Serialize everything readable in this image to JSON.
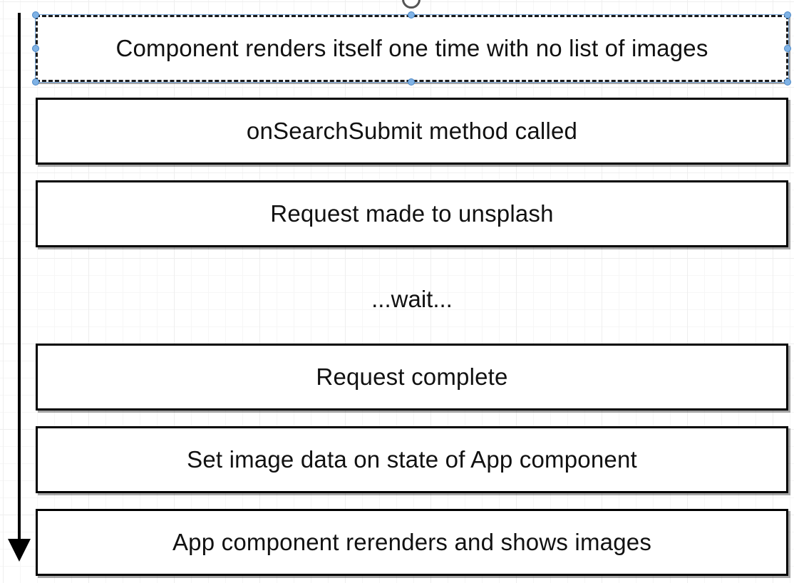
{
  "diagram": {
    "steps": [
      {
        "label": "Component renders itself one time with no list of images"
      },
      {
        "label": "onSearchSubmit method called"
      },
      {
        "label": "Request made to unsplash"
      },
      {
        "label": "Request complete"
      },
      {
        "label": "Set image data on state of App component"
      },
      {
        "label": "App component rerenders and shows images"
      }
    ],
    "wait_label": "...wait..."
  },
  "colors": {
    "box_border": "#000000",
    "selection_handle": "#7fb2e5",
    "grid_line": "#eeeeee"
  }
}
